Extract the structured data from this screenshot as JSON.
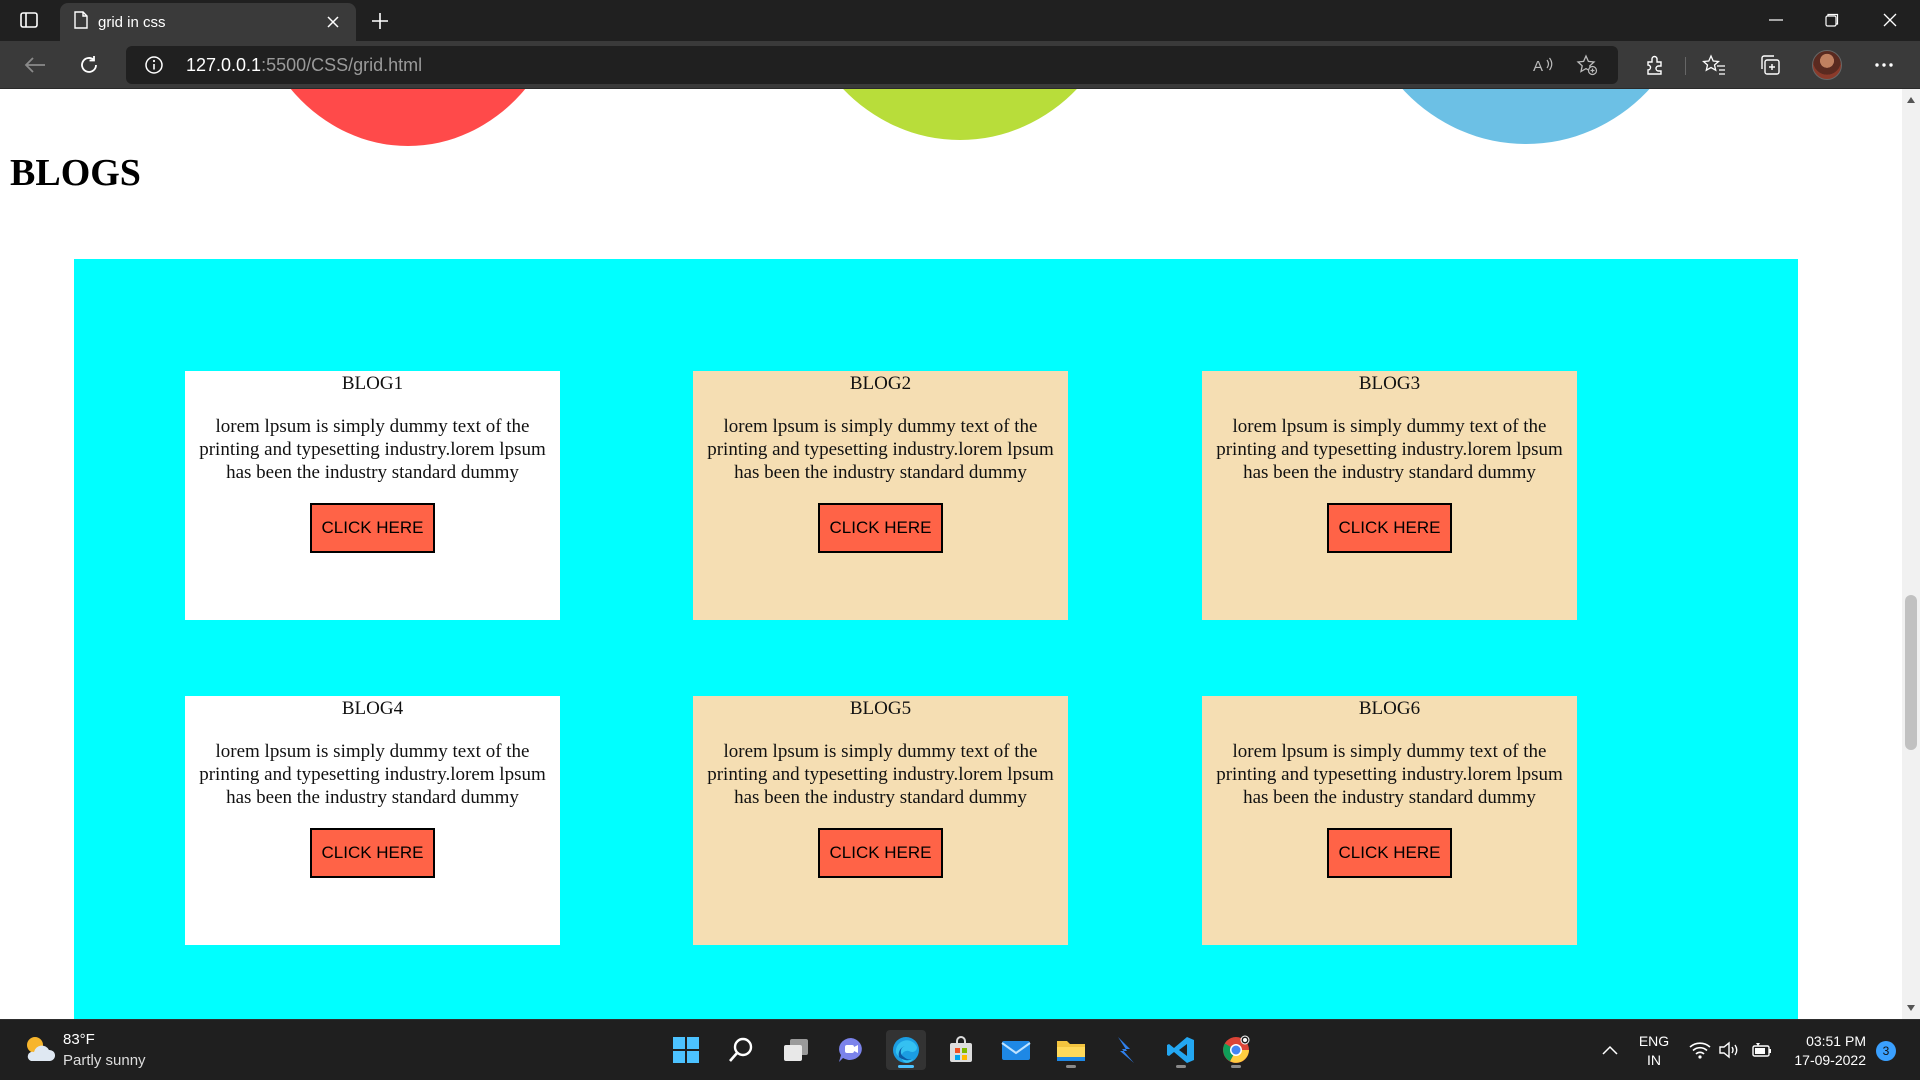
{
  "browser": {
    "tab_title": "grid in css",
    "url_host": "127.0.0.1",
    "url_rest": ":5500/CSS/grid.html"
  },
  "page": {
    "heading": "BLOGS",
    "cards": [
      {
        "title": "BLOG1",
        "text": "lorem lpsum is simply dummy text of the printing and typesetting industry.lorem lpsum has been the industry standard dummy",
        "button": "CLICK HERE",
        "bg": "#ffffff"
      },
      {
        "title": "BLOG2",
        "text": "lorem lpsum is simply dummy text of the printing and typesetting industry.lorem lpsum has been the industry standard dummy",
        "button": "CLICK HERE",
        "bg": "#f5deb3"
      },
      {
        "title": "BLOG3",
        "text": "lorem lpsum is simply dummy text of the printing and typesetting industry.lorem lpsum has been the industry standard dummy",
        "button": "CLICK HERE",
        "bg": "#f5deb3"
      },
      {
        "title": "BLOG4",
        "text": "lorem lpsum is simply dummy text of the printing and typesetting industry.lorem lpsum has been the industry standard dummy",
        "button": "CLICK HERE",
        "bg": "#ffffff"
      },
      {
        "title": "BLOG5",
        "text": "lorem lpsum is simply dummy text of the printing and typesetting industry.lorem lpsum has been the industry standard dummy",
        "button": "CLICK HERE",
        "bg": "#f5deb3"
      },
      {
        "title": "BLOG6",
        "text": "lorem lpsum is simply dummy text of the printing and typesetting industry.lorem lpsum has been the industry standard dummy",
        "button": "CLICK HERE",
        "bg": "#f5deb3"
      }
    ],
    "colors": {
      "grid_bg": "#00ffff",
      "button_bg": "#ff6347",
      "circle_red": "#ff4a4a",
      "circle_green": "#b8dd3a",
      "circle_blue": "#6cc0e5"
    }
  },
  "taskbar": {
    "weather_temp": "83°F",
    "weather_desc": "Partly sunny",
    "lang_line1": "ENG",
    "lang_line2": "IN",
    "time": "03:51 PM",
    "date": "17-09-2022",
    "notification_count": "3"
  }
}
